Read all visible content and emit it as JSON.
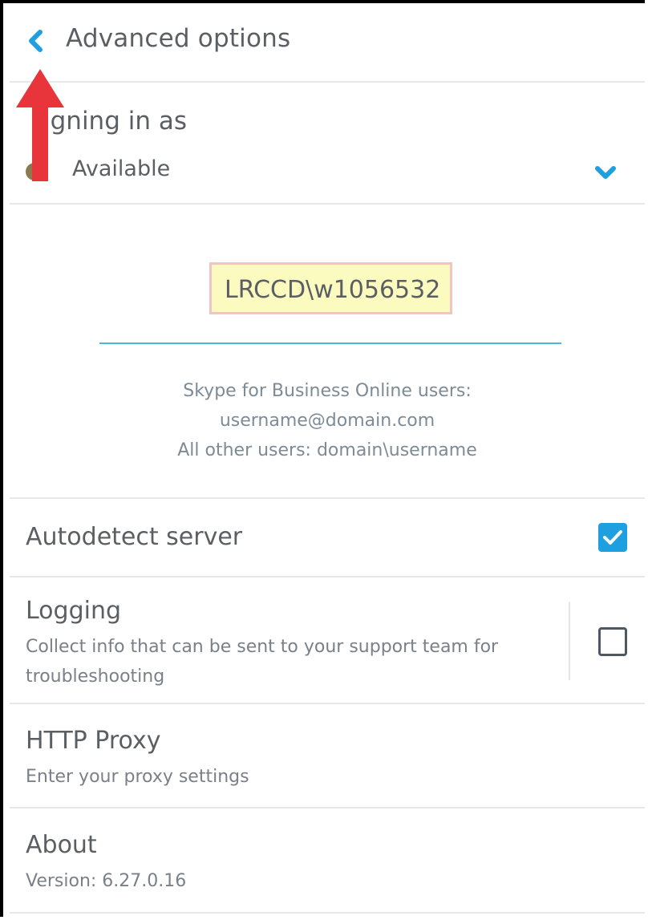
{
  "header": {
    "title": "Advanced options",
    "back_icon": "chevron-left-icon"
  },
  "signin": {
    "label": "igning in as",
    "status": "Available",
    "status_color": "#8a7a4e",
    "dropdown_icon": "chevron-down-icon"
  },
  "user": {
    "username": "LRCCD\\w1056532",
    "hint_line1": "Skype for Business Online users:",
    "hint_line2": "username@domain.com",
    "hint_line3": "All other users: domain\\username"
  },
  "autodetect": {
    "label": "Autodetect server",
    "checked": true
  },
  "logging": {
    "label": "Logging",
    "description_line1": "Collect info that can be sent to your support team for",
    "description_line2": "troubleshooting",
    "checked": false
  },
  "proxy": {
    "label": "HTTP Proxy",
    "description": "Enter your proxy settings"
  },
  "about": {
    "label": "About",
    "version": "Version: 6.27.0.16"
  },
  "colors": {
    "accent": "#1d9fe0",
    "annotation_arrow": "#e8353b",
    "highlight": "#fbfbc0"
  }
}
